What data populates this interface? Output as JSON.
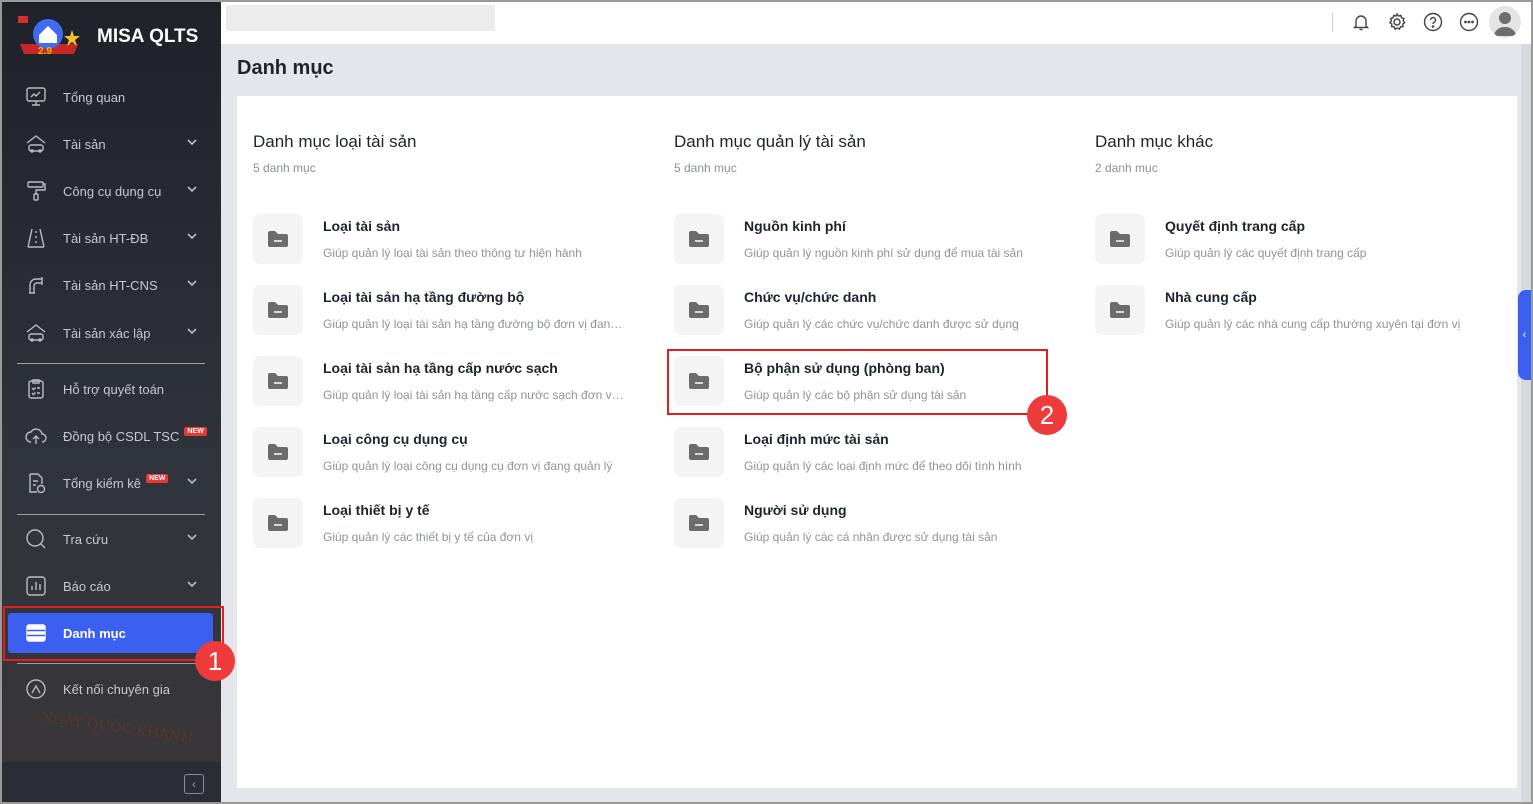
{
  "app": {
    "brand": "MISA QLTS",
    "logo_text": "2.9",
    "watermark_text": "NGÀY QUỐC KHÁNH"
  },
  "sidebar": {
    "items": [
      {
        "label": "Tổng quan",
        "icon": "monitor-chart-icon",
        "chevron": false
      },
      {
        "label": "Tài sản",
        "icon": "house-car-icon",
        "chevron": true
      },
      {
        "label": "Công cụ dụng cụ",
        "icon": "paint-roller-icon",
        "chevron": true
      },
      {
        "label": "Tài sản HT-ĐB",
        "icon": "road-icon",
        "chevron": true
      },
      {
        "label": "Tài sản HT-CNS",
        "icon": "water-pipe-icon",
        "chevron": true
      },
      {
        "label": "Tài sản xác lập",
        "icon": "house-car-icon",
        "chevron": true
      },
      {
        "label": "Hỗ trợ quyết toán",
        "icon": "clipboard-check-icon",
        "chevron": false
      },
      {
        "label": "Đồng bộ CSDL TSC",
        "icon": "cloud-upload-icon",
        "chevron": false,
        "badge": "NEW"
      },
      {
        "label": "Tổng kiểm kê",
        "icon": "document-check-icon",
        "chevron": true,
        "badge": "NEW"
      },
      {
        "label": "Tra cứu",
        "icon": "search-icon",
        "chevron": true
      },
      {
        "label": "Báo cáo",
        "icon": "bar-chart-icon",
        "chevron": true
      },
      {
        "label": "Danh mục",
        "icon": "list-icon",
        "chevron": false,
        "active": true
      },
      {
        "label": "Kết nối chuyên gia",
        "icon": "expert-icon",
        "chevron": false
      }
    ]
  },
  "topbar": {
    "icons": [
      "bell-icon",
      "gear-icon",
      "help-icon",
      "more-icon",
      "avatar-icon"
    ]
  },
  "page": {
    "title": "Danh mục"
  },
  "columns": [
    {
      "title": "Danh mục loại tài sản",
      "count": "5 danh mục",
      "items": [
        {
          "title": "Loại tài sản",
          "desc": "Giúp quản lý loại tài sản theo thông tư hiện hành"
        },
        {
          "title": "Loại tài sản hạ tầng đường bộ",
          "desc": "Giúp quản lý loại tài sản hạ tầng đường bộ đơn vị đang quản lý"
        },
        {
          "title": "Loại tài sản hạ tầng cấp nước sạch",
          "desc": "Giúp quản lý loại tài sản hạ tầng cấp nước sạch đơn vị đang quản lý"
        },
        {
          "title": "Loại công cụ dụng cụ",
          "desc": "Giúp quản lý loại công cụ dụng cụ đơn vị đang quản lý"
        },
        {
          "title": "Loại thiết bị y tế",
          "desc": "Giúp quản lý các thiết bị y tế của đơn vị"
        }
      ]
    },
    {
      "title": "Danh mục quản lý tài sản",
      "count": "5 danh mục",
      "items": [
        {
          "title": "Nguồn kinh phí",
          "desc": "Giúp quản lý nguồn kinh phí sử dụng để mua tài sản"
        },
        {
          "title": "Chức vụ/chức danh",
          "desc": "Giúp quản lý các chức vụ/chức danh được sử dụng"
        },
        {
          "title": "Bộ phận sử dụng (phòng ban)",
          "desc": "Giúp quản lý các bộ phận sử dụng tài sản"
        },
        {
          "title": "Loại định mức tài sản",
          "desc": "Giúp quản lý các loại định mức để theo dõi tình hình"
        },
        {
          "title": "Người sử dụng",
          "desc": "Giúp quản lý các cá nhân được sử dụng tài sản"
        }
      ]
    },
    {
      "title": "Danh mục khác",
      "count": "2 danh mục",
      "items": [
        {
          "title": "Quyết định trang cấp",
          "desc": "Giúp quản lý các quyết định trang cấp"
        },
        {
          "title": "Nhà cung cấp",
          "desc": "Giúp quản lý các nhà cung cấp thường xuyên tại đơn vị"
        }
      ]
    }
  ],
  "annotations": {
    "step1": "1",
    "step2": "2",
    "color": "#e02020"
  },
  "colors": {
    "accent": "#3b5ff0",
    "sidebar": "#262a31"
  }
}
